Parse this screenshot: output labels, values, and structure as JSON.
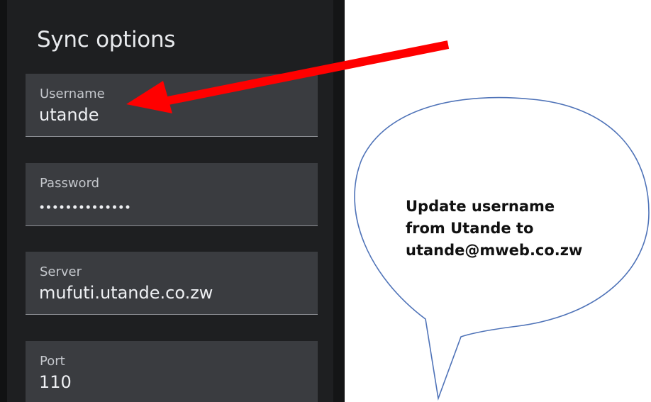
{
  "panel": {
    "title": "Sync options",
    "fields": {
      "username": {
        "label": "Username",
        "value": "utande"
      },
      "password": {
        "label": "Password",
        "masked_value": "••••••••••••••"
      },
      "server": {
        "label": "Server",
        "value": "mufuti.utande.co.zw"
      },
      "port": {
        "label": "Port",
        "value": "110"
      }
    }
  },
  "annotation": {
    "callout_lines": [
      "Update username",
      "from Utande to",
      "utande@mweb.co.zw"
    ],
    "arrow_color": "#ff0000",
    "bubble_stroke": "#4f73b8",
    "icons": [
      "red-arrow",
      "speech-bubble"
    ]
  },
  "colors": {
    "panel_bg": "#1e1f21",
    "field_bg": "#3a3c40",
    "text": "#eef0f3",
    "label": "#c4c7cc"
  }
}
